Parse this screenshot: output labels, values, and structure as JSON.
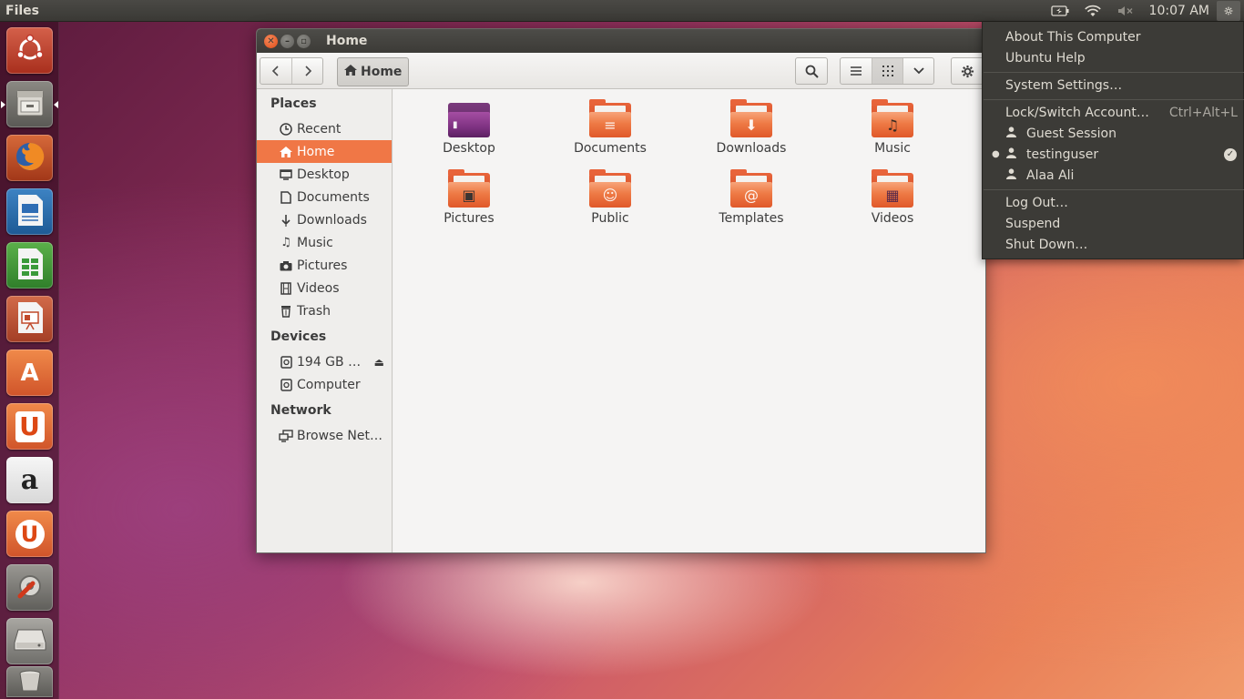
{
  "top_panel": {
    "app_title": "Files",
    "clock": "10:07 AM",
    "indicators": [
      "battery-icon",
      "wifi-icon",
      "volume-muted-icon",
      "gear-icon"
    ]
  },
  "launcher": {
    "items": [
      {
        "name": "dash-home",
        "icon": "ubuntu-logo-icon"
      },
      {
        "name": "files",
        "icon": "file-cabinet-icon",
        "active": true
      },
      {
        "name": "firefox",
        "icon": "firefox-icon"
      },
      {
        "name": "writer",
        "icon": "libreoffice-writer-icon"
      },
      {
        "name": "calc",
        "icon": "libreoffice-calc-icon"
      },
      {
        "name": "impress",
        "icon": "libreoffice-impress-icon"
      },
      {
        "name": "software-center",
        "icon": "shopping-bag-icon",
        "glyph": "A"
      },
      {
        "name": "ubuntu-one",
        "icon": "ubuntu-one-icon",
        "glyph": "U"
      },
      {
        "name": "amazon",
        "icon": "amazon-icon",
        "glyph": "a"
      },
      {
        "name": "ubuntu-one-music",
        "icon": "ubuntu-one-music-icon",
        "glyph": "U"
      },
      {
        "name": "system-settings",
        "icon": "settings-wrench-icon"
      },
      {
        "name": "drive",
        "icon": "hard-drive-icon"
      },
      {
        "name": "trash",
        "icon": "trash-icon"
      }
    ]
  },
  "window": {
    "title": "Home",
    "path_button": "Home",
    "colors": {
      "selection": "#f07746",
      "folder": "#ee7a45"
    }
  },
  "sidebar": {
    "places_header": "Places",
    "places": [
      {
        "label": "Recent",
        "icon": "clock-icon"
      },
      {
        "label": "Home",
        "icon": "home-icon",
        "selected": true
      },
      {
        "label": "Desktop",
        "icon": "desktop-icon"
      },
      {
        "label": "Documents",
        "icon": "document-icon"
      },
      {
        "label": "Downloads",
        "icon": "download-icon"
      },
      {
        "label": "Music",
        "icon": "music-note-icon"
      },
      {
        "label": "Pictures",
        "icon": "camera-icon"
      },
      {
        "label": "Videos",
        "icon": "film-icon"
      },
      {
        "label": "Trash",
        "icon": "trash-icon"
      }
    ],
    "devices_header": "Devices",
    "devices": [
      {
        "label": "194 GB …",
        "icon": "drive-icon"
      },
      {
        "label": "Computer",
        "icon": "drive-icon"
      }
    ],
    "network_header": "Network",
    "network": [
      {
        "label": "Browse Net…",
        "icon": "network-icon"
      }
    ]
  },
  "content": {
    "items": [
      {
        "label": "Desktop",
        "icon": "desktop-folder-icon"
      },
      {
        "label": "Documents",
        "icon": "documents-folder-icon",
        "emblem": "≡"
      },
      {
        "label": "Downloads",
        "icon": "downloads-folder-icon",
        "emblem": "⬇"
      },
      {
        "label": "Music",
        "icon": "music-folder-icon",
        "emblem": "♫"
      },
      {
        "label": "Pictures",
        "icon": "pictures-folder-icon",
        "emblem": "▣"
      },
      {
        "label": "Public",
        "icon": "public-folder-icon",
        "emblem": "☺"
      },
      {
        "label": "Templates",
        "icon": "templates-folder-icon",
        "emblem": "@"
      },
      {
        "label": "Videos",
        "icon": "videos-folder-icon",
        "emblem": "▦"
      }
    ]
  },
  "session_menu": {
    "about": "About This Computer",
    "help": "Ubuntu Help",
    "system_settings": "System Settings…",
    "lock_switch": "Lock/Switch Account…",
    "lock_accel": "Ctrl+Alt+L",
    "users": [
      {
        "name": "Guest Session",
        "current": false
      },
      {
        "name": "testinguser",
        "current": true
      },
      {
        "name": "Alaa Ali",
        "current": false
      }
    ],
    "log_out": "Log Out…",
    "suspend": "Suspend",
    "shut_down": "Shut Down…"
  }
}
